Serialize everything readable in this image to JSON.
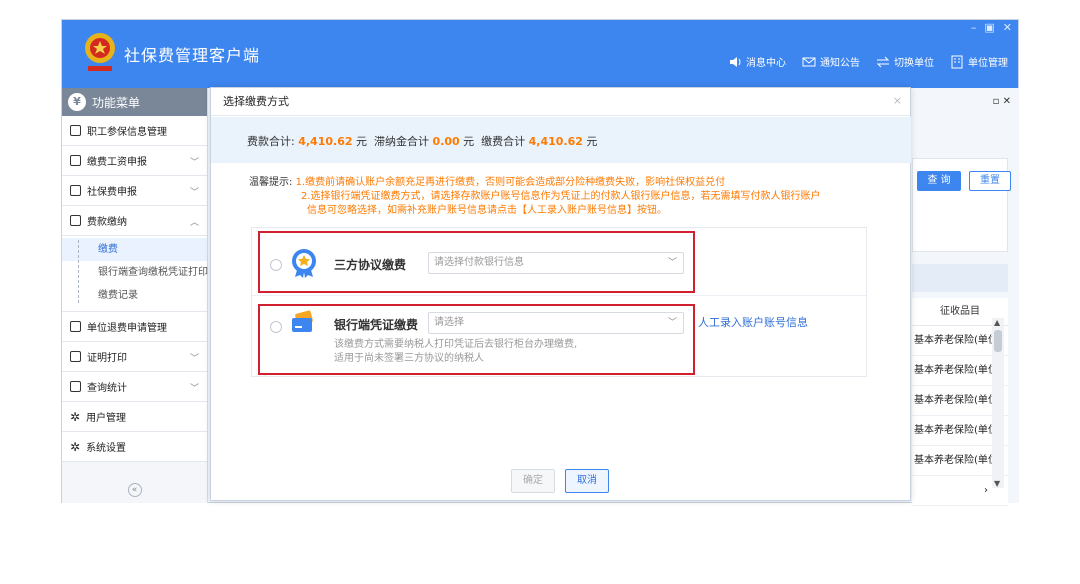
{
  "app": {
    "title": "社保费管理客户端",
    "window_controls": [
      "–",
      "▣",
      "✕"
    ],
    "header_actions": [
      {
        "icon": "speaker-icon",
        "label": "消息中心"
      },
      {
        "icon": "mail-icon",
        "label": "通知公告"
      },
      {
        "icon": "switch-icon",
        "label": "切换单位"
      },
      {
        "icon": "building-icon",
        "label": "单位管理"
      }
    ]
  },
  "sidebar": {
    "heading": "功能菜单",
    "heading_icon": "¥",
    "items": [
      {
        "label": "职工参保信息管理",
        "icon": "list-icon",
        "chevron": ""
      },
      {
        "label": "缴费工资申报",
        "icon": "edit-icon",
        "chevron": "﹀"
      },
      {
        "label": "社保费申报",
        "icon": "form-icon",
        "chevron": "﹀"
      },
      {
        "label": "费款缴纳",
        "icon": "payment-icon",
        "chevron": "︿"
      }
    ],
    "sub_items": [
      "缴费",
      "银行端查询缴税凭证打印",
      "缴费记录"
    ],
    "items_after": [
      {
        "label": "单位退费申请管理",
        "icon": "list-icon",
        "chevron": ""
      },
      {
        "label": "证明打印",
        "icon": "print-icon",
        "chevron": "﹀"
      },
      {
        "label": "查询统计",
        "icon": "chart-icon",
        "chevron": "﹀"
      },
      {
        "label": "用户管理",
        "icon": "gear-icon",
        "chevron": ""
      },
      {
        "label": "系统设置",
        "icon": "gear-icon",
        "chevron": ""
      }
    ],
    "collapse_label": "«"
  },
  "background": {
    "tab_controls": "▫ ✕",
    "query_button": "查 询",
    "reset_button": "重置",
    "table_header": "征收品目",
    "table_rows": [
      "基本养老保险(单位",
      "基本养老保险(单位",
      "基本养老保险(单位",
      "基本养老保险(单位",
      "基本养老保险(单位"
    ],
    "scroll_right": "›"
  },
  "modal": {
    "title": "选择缴费方式",
    "close": "×",
    "totals": {
      "fee_label": "费款合计:",
      "fee_value": "4,410.62",
      "late_label": "滞纳金合计",
      "late_value": "0.00",
      "pay_label": "缴费合计",
      "pay_value": "4,410.62",
      "unit": "元"
    },
    "tip": {
      "label": "温馨提示:",
      "line1": "1.缴费前请确认账户余额充足再进行缴费，否则可能会造成部分险种缴费失败，影响社保权益兑付",
      "line2": "2.选择银行端凭证缴费方式，请选择存款账户账号信息作为凭证上的付款人银行账户信息，若无需填写付款人银行账户",
      "line3": "信息可忽略选择，如需补充账户账号信息请点击【人工录入账户账号信息】按钮。"
    },
    "options": [
      {
        "name": "三方协议缴费",
        "icon": "badge-icon",
        "select_placeholder": "请选择付款银行信息"
      },
      {
        "name": "银行端凭证缴费",
        "icon": "card-icon",
        "select_placeholder": "请选择",
        "link": "人工录入账户账号信息",
        "desc1": "该缴费方式需要纳税人打印凭证后去银行柜台办理缴费,",
        "desc2": "适用于尚未签署三方协议的纳税人"
      }
    ],
    "ok_button": "确定",
    "cancel_button": "取消"
  },
  "colors": {
    "brand_blue": "#3d86f0",
    "accent_orange": "#ff7a00",
    "highlight_red": "#d12030"
  }
}
